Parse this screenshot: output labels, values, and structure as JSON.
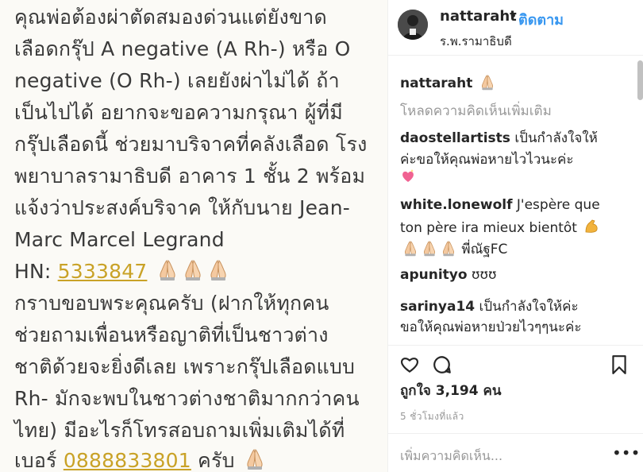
{
  "post": {
    "lines": [
      "คุณพ่อต้องผ่าตัดสมองด่วนแต่ยังขาด",
      "เลือดกรุ๊ป A negative (A Rh-) หรือ O",
      "negative (O Rh-) เลยยังผ่าไม่ได้ ถ้า",
      "เป็นไปได้ อยากจะขอความกรุณา ผู้ที่มี",
      "กรุ๊ปเลือดนี้ ช่วยมาบริจาคที่คลังเลือด โรง",
      "พยาบาลรามาธิบดี อาคาร 1 ชั้น 2 พร้อม",
      "แจ้งว่าประสงค์บริจาค ให้กับนาย Jean-",
      "Marc Marcel Legrand"
    ],
    "hn_label": "HN: ",
    "hn_number": "5333847",
    "lines2": [
      "กราบขอบพระคุณครับ (ฝากให้ทุกคน",
      "ช่วยถามเพื่อนหรือญาติที่เป็นชาวต่าง",
      "ชาติด้วยจะยิ่งดีเลย เพราะกรุ๊ปเลือดแบบ",
      "Rh- มักจะพบในชาวต่างชาติมากกว่าคน",
      "ไทย) มีอะไรก็โทรสอบถามเพิ่มเติมได้ที่"
    ],
    "phone_prefix": "เบอร์ ",
    "phone": "0888833801",
    "phone_suffix": " ครับ"
  },
  "header": {
    "username": "nattaraht",
    "dot": "•",
    "follow_label": "ติดตาม",
    "location": "ร.พ.รามาธิบดี"
  },
  "comments": {
    "caption_user": "nattaraht",
    "load_more": "โหลดความคิดเห็นเพิ่มเติม",
    "items": [
      {
        "user": "daostellartists",
        "line1": "เป็นกำลังใจให้",
        "line2": "ค่ะขอให้คุณพ่อหายไวไวนะค่ะ"
      },
      {
        "user": "white.lonewolf",
        "line1": "J'espère que",
        "line2": "ton père ira mieux bientôt",
        "line3": "พี่ณัฐFC"
      },
      {
        "user": "apunityo",
        "line1": "ʊʊʊ"
      },
      {
        "user": "sarinya14",
        "line1": "เป็นกำลังใจให้ค่ะ",
        "line2": "ขอให้คุณพ่อหายป่วยไวๆๆนะค่ะ"
      }
    ]
  },
  "likes": {
    "label": "ถูกใจ",
    "count": "3,194",
    "unit": "คน"
  },
  "time": "5 ชั่วโมงที่แล้ว",
  "add_comment_placeholder": "เพิ่มความคิดเห็น...",
  "more_label": "•••",
  "colors": {
    "link": "#3897f0",
    "highlight": "#c9a227",
    "post_bg": "#fbfaf6"
  },
  "icons": [
    "folded-hands-icon",
    "sparkling-heart-icon",
    "flexed-biceps-icon",
    "heart-icon",
    "comment-icon",
    "bookmark-icon"
  ]
}
